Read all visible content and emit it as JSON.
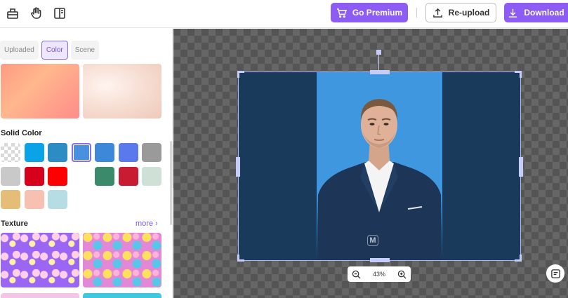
{
  "toolbar": {
    "icons": [
      "layers-icon",
      "hand-icon",
      "split-view-icon"
    ],
    "premium_label": "Go Premium",
    "reupload_label": "Re-upload",
    "download_label": "Download"
  },
  "panel": {
    "tabs": [
      {
        "label": "Uploaded",
        "active": false
      },
      {
        "label": "Color",
        "active": true
      },
      {
        "label": "Scene",
        "active": false
      }
    ],
    "solid_color_title": "Solid Color",
    "texture_title": "Texture",
    "more_label": "more ›",
    "swatches": [
      "transparent",
      "#0aa3e8",
      "#2e8cc4",
      "#4a90e2",
      "#3d88d9",
      "#5a79ec",
      "#9a9a9a",
      "#c9c9c9",
      "#d6001c",
      "#ff0000",
      "#ffffff",
      "#3a8a6b",
      "#c91c33",
      "#cfe1d6",
      "#e5bd77",
      "#f7c0b0",
      "#b7dde4"
    ],
    "selected_swatch": 3
  },
  "canvas": {
    "zoom_label": "43%",
    "watermark": "M"
  },
  "colors": {
    "accent": "#8c5cf4",
    "frame_dark": "#1a3a5c",
    "frame_blue": "#3f98df"
  }
}
